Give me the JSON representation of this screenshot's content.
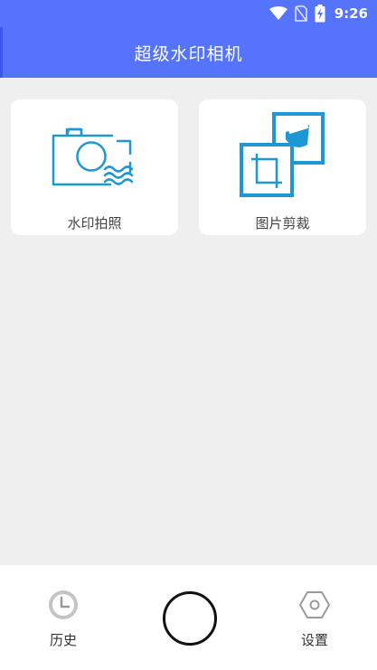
{
  "status_bar": {
    "time": "9:26",
    "icons": [
      "wifi-icon",
      "no-sim-icon",
      "battery-charging-icon"
    ]
  },
  "app": {
    "title": "超级水印相机"
  },
  "colors": {
    "primary": "#5674fb",
    "icon_blue": "#1e97d6",
    "background": "#efefef"
  },
  "cards": [
    {
      "label": "水印拍照",
      "icon": "watermark-camera-icon"
    },
    {
      "label": "图片剪裁",
      "icon": "image-crop-icon"
    }
  ],
  "bottom_nav": {
    "history_label": "历史",
    "history_icon": "clock-icon",
    "capture_icon": "shutter-button",
    "settings_label": "设置",
    "settings_icon": "hexagon-settings-icon"
  }
}
